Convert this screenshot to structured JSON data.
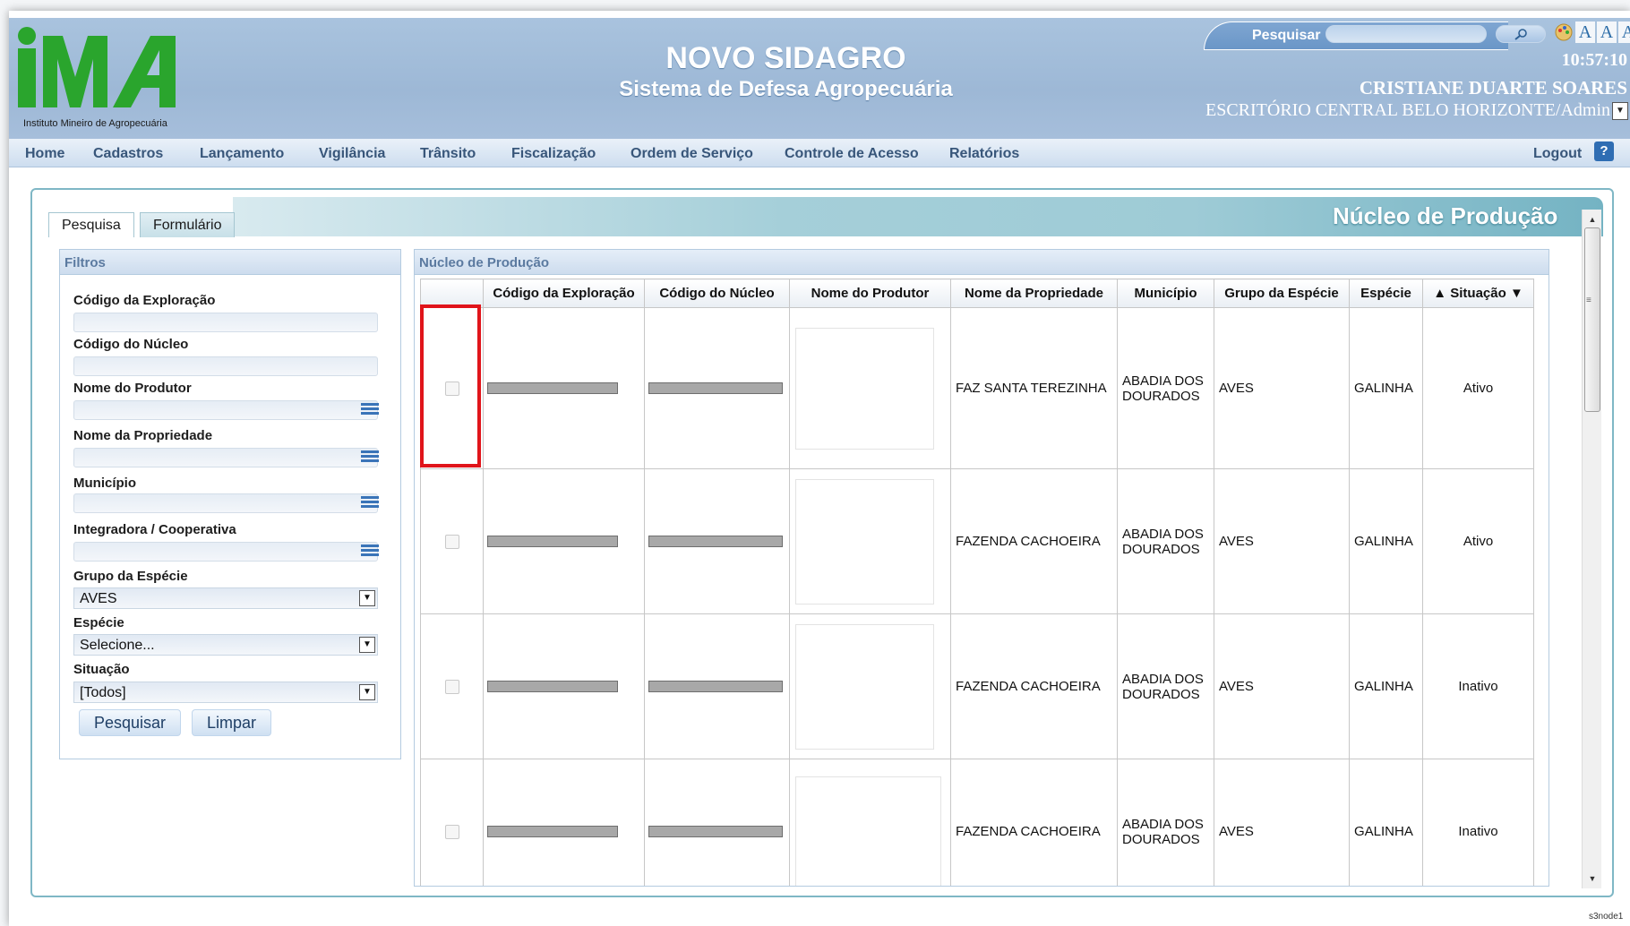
{
  "header": {
    "logo_text": "IMA",
    "logo_caption": "Instituto Mineiro de Agropecuária",
    "title": "NOVO SIDAGRO",
    "subtitle": "Sistema de Defesa Agropecuária",
    "search_label": "Pesquisar",
    "search_value": "",
    "clock": "10:57:10",
    "user_name": "CRISTIANE DUARTE SOARES",
    "office": "ESCRITÓRIO CENTRAL BELO HORIZONTE/Admin",
    "font_buttons": [
      "A",
      "A",
      "A"
    ]
  },
  "nav": {
    "items": [
      "Home",
      "Cadastros",
      "Lançamento",
      "Vigilância",
      "Trânsito",
      "Fiscalização",
      "Ordem de Serviço",
      "Controle de Acesso",
      "Relatórios"
    ],
    "logout": "Logout",
    "help": "?"
  },
  "page": {
    "title": "Núcleo de Produção",
    "tabs": [
      "Pesquisa",
      "Formulário"
    ]
  },
  "filters": {
    "heading": "Filtros",
    "codigo_exploracao": "Código da Exploração",
    "codigo_nucleo": "Código do Núcleo",
    "nome_produtor": "Nome do Produtor",
    "nome_propriedade": "Nome da Propriedade",
    "municipio": "Município",
    "integradora": "Integradora / Cooperativa",
    "grupo_especie_label": "Grupo da Espécie",
    "grupo_especie_value": "AVES",
    "especie_label": "Espécie",
    "especie_value": "Selecione...",
    "situacao_label": "Situação",
    "situacao_value": "[Todos]",
    "btn_search": "Pesquisar",
    "btn_clear": "Limpar"
  },
  "results": {
    "heading": "Núcleo de Produção",
    "columns": [
      "Código da Exploração",
      "Código do Núcleo",
      "Nome do Produtor",
      "Nome da Propriedade",
      "Município",
      "Grupo da Espécie",
      "Espécie",
      "Situação"
    ],
    "rows": [
      {
        "propriedade": "FAZ SANTA TEREZINHA",
        "municipio": "ABADIA DOS DOURADOS",
        "grupo": "AVES",
        "especie": "GALINHA",
        "situacao": "Ativo"
      },
      {
        "propriedade": "FAZENDA CACHOEIRA",
        "municipio": "ABADIA DOS DOURADOS",
        "grupo": "AVES",
        "especie": "GALINHA",
        "situacao": "Ativo"
      },
      {
        "propriedade": "FAZENDA CACHOEIRA",
        "municipio": "ABADIA DOS DOURADOS",
        "grupo": "AVES",
        "especie": "GALINHA",
        "situacao": "Inativo"
      },
      {
        "propriedade": "FAZENDA CACHOEIRA",
        "municipio": "ABADIA DOS DOURADOS",
        "grupo": "AVES",
        "especie": "GALINHA",
        "situacao": "Inativo"
      }
    ]
  },
  "footer": {
    "node": "s3node1"
  },
  "colors": {
    "header_bg": "#a9c3de",
    "accent": "#2f6db3",
    "highlight": "#e0141a",
    "logo_green": "#2aa52d"
  }
}
